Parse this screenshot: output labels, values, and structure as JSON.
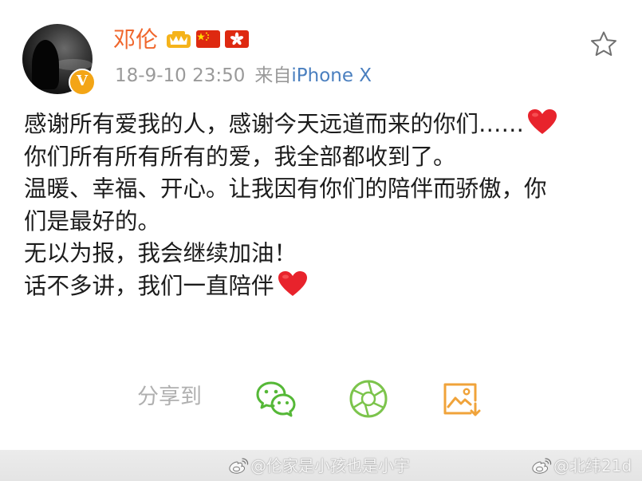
{
  "post": {
    "username": "邓伦",
    "badges": [
      "crown-badge-icon",
      "china-flag-icon",
      "hong-kong-flag-icon"
    ],
    "verified_mark": "V",
    "timestamp": "18-9-10 23:50",
    "source_prefix": "来自",
    "source_device": "iPhone X",
    "content_lines": [
      "感谢所有爱我的人，感谢今天远道而来的你们……",
      "你们所有所有所有的爱，我全部都收到了。",
      "温暖、幸福、开心。让我因有你们的陪伴而骄傲，你",
      "们是最好的。",
      "无以为报，我会继续加油！",
      "话不多讲，我们一直陪伴"
    ],
    "emoji": [
      "red-heart-icon",
      "red-heart-icon"
    ]
  },
  "share": {
    "label": "分享到",
    "targets": [
      "wechat-icon",
      "moments-icon",
      "save-image-icon"
    ]
  },
  "watermarks": {
    "left": "@伦家是小孩也是小宇",
    "right": "@北纬21d"
  },
  "colors": {
    "username": "#f0672d",
    "source_link": "#4a7fbf",
    "meta_text": "#9a9a9a",
    "body_text": "#1c1c1c",
    "wechat_green": "#55b837",
    "save_orange": "#f0a33a",
    "heart_red": "#e8232c"
  }
}
